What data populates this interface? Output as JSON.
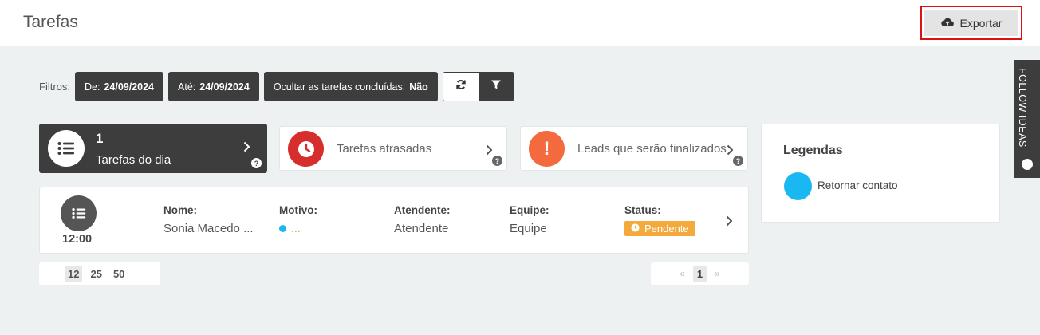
{
  "header": {
    "title": "Tarefas",
    "export_label": "Exportar"
  },
  "filters": {
    "label": "Filtros:",
    "from_label": "De:",
    "from_value": "24/09/2024",
    "to_label": "Até:",
    "to_value": "24/09/2024",
    "hide_label": "Ocultar as tarefas concluídas:",
    "hide_value": "Não"
  },
  "cards": {
    "day": {
      "count": "1",
      "label": "Tarefas do dia"
    },
    "late": {
      "label": "Tarefas atrasadas"
    },
    "leads": {
      "label": "Leads que serão finalizados"
    },
    "help": "?"
  },
  "legend": {
    "title": "Legendas",
    "items": [
      {
        "label": "Retornar contato",
        "color": "#1ab8f2"
      }
    ]
  },
  "task": {
    "time": "12:00",
    "nome_label": "Nome:",
    "nome_value": "Sonia Macedo ...",
    "motivo_label": "Motivo:",
    "motivo_value": "...",
    "atendente_label": "Atendente:",
    "atendente_value": "Atendente",
    "equipe_label": "Equipe:",
    "equipe_value": "Equipe",
    "status_label": "Status:",
    "status_value": "Pendente"
  },
  "pagination": {
    "sizes": [
      "12",
      "25",
      "50"
    ],
    "selected_size": "12",
    "prev": "«",
    "page": "1",
    "next": "»"
  },
  "follow": {
    "label": "FOLLOW IDEAS"
  },
  "colors": {
    "dark": "#3d3d3d",
    "late_red": "#d62d2d",
    "leads_orange": "#f26a3d",
    "legend_blue": "#1ab8f2",
    "pending_orange": "#f4a93d"
  }
}
